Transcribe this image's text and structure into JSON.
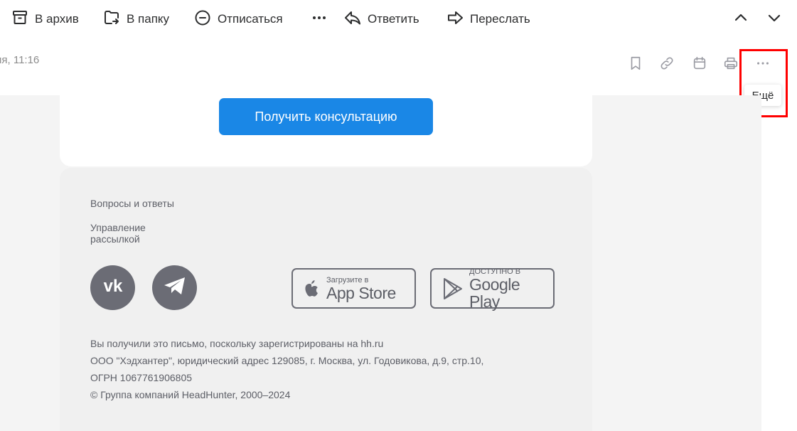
{
  "toolbar": {
    "archive_label": "В архив",
    "folder_label": "В папку",
    "unsubscribe_label": "Отписаться",
    "reply_label": "Ответить",
    "forward_label": "Переслать"
  },
  "header": {
    "date_text": "ия, 11:16",
    "tooltip_text": "Ещё"
  },
  "email": {
    "cta_label": "Получить консультацию",
    "footer": {
      "links": [
        "Вопросы и ответы",
        "Управление рассылкой"
      ],
      "app_store": {
        "small": "Загрузите в",
        "big": "App Store"
      },
      "google_play": {
        "small": "ДОСТУПНО В",
        "big": "Google Play"
      },
      "legal": [
        "Вы получили это письмо, поскольку зарегистрированы на hh.ru",
        "ООО \"Хэдхантер\", юридический адрес 129085, г. Москва, ул. Годовикова, д.9, стр.10,",
        "ОГРН 1067761906805",
        "© Группа компаний HeadHunter, 2000–2024"
      ]
    }
  },
  "colors": {
    "accent": "#1a87e6",
    "highlight": "#ff0000",
    "footer_bg": "#f0f0f0",
    "icon_gray": "#6b6c75"
  }
}
